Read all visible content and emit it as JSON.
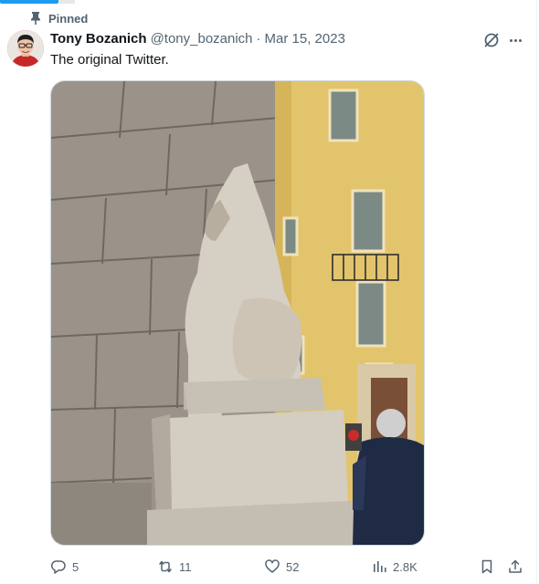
{
  "pinned": {
    "label": "Pinned",
    "icon": "pin-icon"
  },
  "author": {
    "name": "Tony Bozanich",
    "handle": "@tony_bozanich",
    "separator": "·",
    "date": "Mar 15, 2023",
    "avatar_icon": "avatar"
  },
  "tweet": {
    "text": "The original Twitter."
  },
  "media": {
    "kind": "photo",
    "subject": "statue"
  },
  "actions": {
    "replies": "5",
    "retweets": "11",
    "likes": "52",
    "views": "2.8K"
  },
  "colors": {
    "accent": "#1d9bf0",
    "text_primary": "#0f1419",
    "text_secondary": "#536471",
    "border": "#cfd9de"
  }
}
